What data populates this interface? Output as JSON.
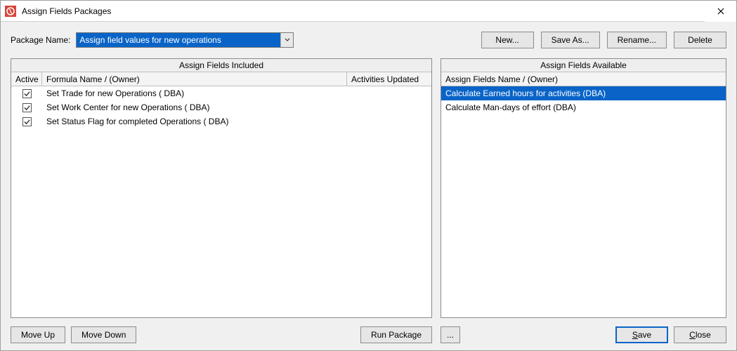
{
  "window": {
    "title": "Assign Fields Packages"
  },
  "toolbar": {
    "new_label": "New...",
    "saveas_label": "Save As...",
    "rename_label": "Rename...",
    "delete_label": "Delete"
  },
  "package": {
    "label": "Package Name:",
    "value": "Assign field values for new operations"
  },
  "left_panel": {
    "title": "Assign Fields Included",
    "cols": {
      "active": "Active",
      "name": "Formula Name / (Owner)",
      "activities": "Activities Updated"
    },
    "rows": [
      {
        "active": true,
        "name": "Set Trade for new Operations ( DBA)",
        "activities": ""
      },
      {
        "active": true,
        "name": "Set Work Center for new Operations ( DBA)",
        "activities": ""
      },
      {
        "active": true,
        "name": "Set Status Flag for completed Operations ( DBA)",
        "activities": ""
      }
    ]
  },
  "right_panel": {
    "title": "Assign Fields Available",
    "cols": {
      "name": "Assign Fields Name  / (Owner)"
    },
    "rows": [
      {
        "name": "Calculate Earned hours for activities (DBA)",
        "selected": true
      },
      {
        "name": "Calculate Man-days of effort (DBA)",
        "selected": false
      }
    ]
  },
  "bottom": {
    "moveup_label": "Move Up",
    "movedown_label": "Move Down",
    "run_label": "Run Package",
    "ellipsis_label": "...",
    "save_label": "Save",
    "close_label": "Close",
    "save_mnemonic_index": 0,
    "close_mnemonic_index": 0
  }
}
